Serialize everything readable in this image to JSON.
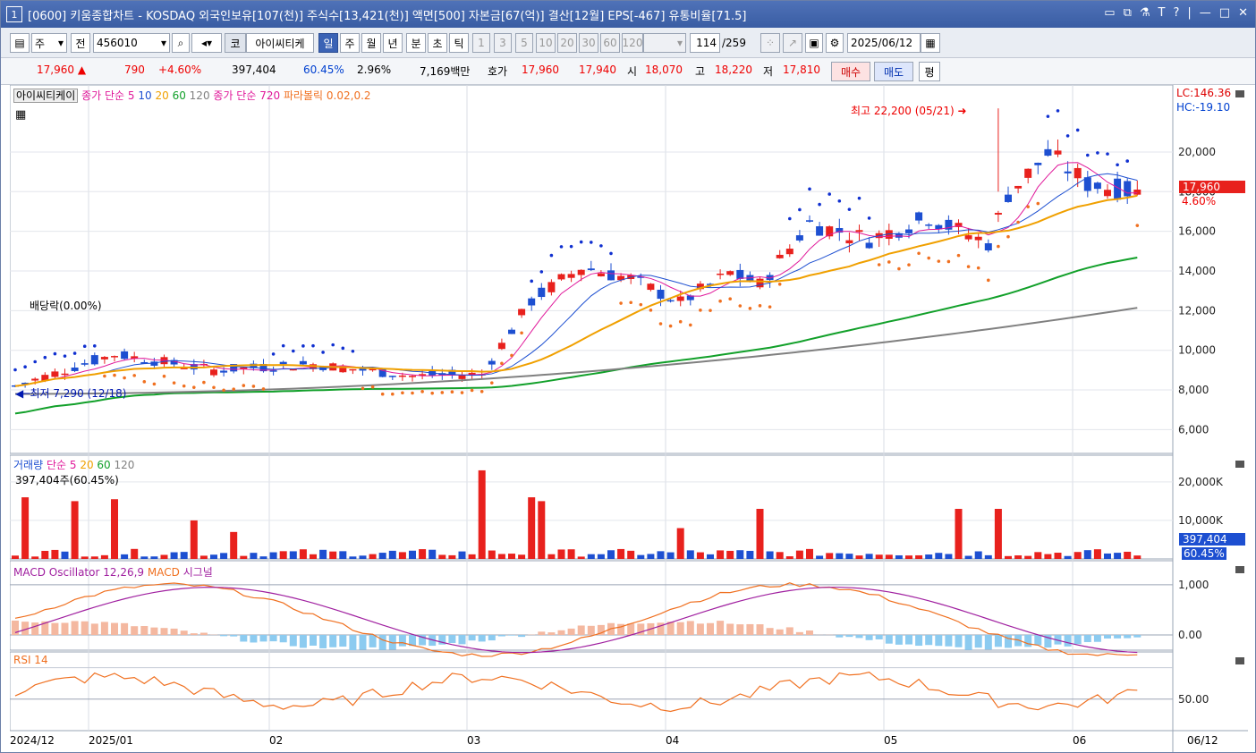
{
  "titlebar": {
    "number": "1",
    "title": "[0600] 키움종합차트 - KOSDAQ 외국인보유[107(천)] 주식수[13,421(천)] 액면[500] 자본금[67(억)] 결산[12월] EPS[-467] 유통비율[71.5]",
    "controls": [
      "▭",
      "⧉",
      "⚗",
      "T",
      "?",
      "|",
      "—",
      "□",
      "✕"
    ]
  },
  "toolbar": {
    "period_type": "주",
    "prev": "전",
    "code": "456010",
    "market_btn": "코",
    "stock_name": "아이씨티케",
    "periods": [
      "일",
      "주",
      "월",
      "년"
    ],
    "active_period": "일",
    "intraday": [
      "분",
      "초",
      "틱"
    ],
    "minutes": [
      "1",
      "3",
      "5",
      "10",
      "20",
      "30",
      "60",
      "120"
    ],
    "page": "114",
    "total": "/259",
    "date": "2025/06/12"
  },
  "quote": {
    "price": "17,960",
    "arrow": "▲",
    "change": "790",
    "change_pct": "+4.60%",
    "volume": "397,404",
    "vol_ratio": "60.45%",
    "turnover": "2.96%",
    "amount": "7,169백만",
    "ask_label": "호가",
    "ask": "17,960",
    "bid": "17,940",
    "open_label": "시",
    "open": "18,070",
    "high_label": "고",
    "high": "18,220",
    "low_label": "저",
    "low": "17,810",
    "buy": "매수",
    "sell": "매도",
    "eval": "평"
  },
  "panels": {
    "price": {
      "legend": [
        "아이씨티케이",
        "종가 단순 5",
        "10",
        "20",
        "60",
        "120",
        "종가 단순 720",
        "파라볼릭 0.02,0.2"
      ],
      "lc": "LC:146.36",
      "hc": "HC:-19.10",
      "high_annot": "최고 22,200 (05/21)",
      "low_annot": "최저 7,290 (12/18)",
      "dividend_annot": "배당락(0.00%)",
      "price_tag": "17,960",
      "pct_tag": "4.60%"
    },
    "volume": {
      "legend": [
        "거래량",
        "단순 5",
        "20",
        "60",
        "120"
      ],
      "value": "397,404주(60.45%)",
      "tag": "397,404",
      "pct_tag": "60.45%"
    },
    "macd": {
      "legend": [
        "MACD Oscillator 12,26,9",
        "MACD",
        "시그널"
      ]
    },
    "rsi": {
      "legend": [
        "RSI 14"
      ]
    },
    "xaxis": {
      "labels": [
        "2024/12",
        "2025/01",
        "02",
        "03",
        "04",
        "05",
        "06"
      ],
      "right": "06/12"
    }
  },
  "colors": {
    "up": "#e8211d",
    "down": "#1d4fd1",
    "ma5": "#e0189a",
    "ma10": "#1d4fd1",
    "ma20": "#f0a000",
    "ma60": "#12a02a",
    "ma120": "#808080",
    "sar": "#1030d0",
    "macd": "#a020a0",
    "signal": "#f07020"
  },
  "chart_data": [
    {
      "type": "candlestick",
      "title": "아이씨티케이",
      "y_ticks": [
        6000,
        8000,
        10000,
        12000,
        14000,
        16000,
        18000,
        20000
      ],
      "ylim": [
        4800,
        23200
      ],
      "x_labels": [
        "2024/12",
        "2025/01",
        "02",
        "03",
        "04",
        "05",
        "06"
      ],
      "last_close": 17960,
      "high": 22200,
      "low": 7290
    },
    {
      "type": "bar",
      "title": "거래량",
      "y_ticks": [
        "10,000K",
        "20,000K"
      ],
      "last_value": 397404
    },
    {
      "type": "line",
      "title": "MACD Oscillator 12,26,9",
      "y_ticks": [
        "0.00",
        "1,000"
      ]
    },
    {
      "type": "line",
      "title": "RSI 14",
      "y_ticks": [
        "50.00"
      ]
    }
  ]
}
